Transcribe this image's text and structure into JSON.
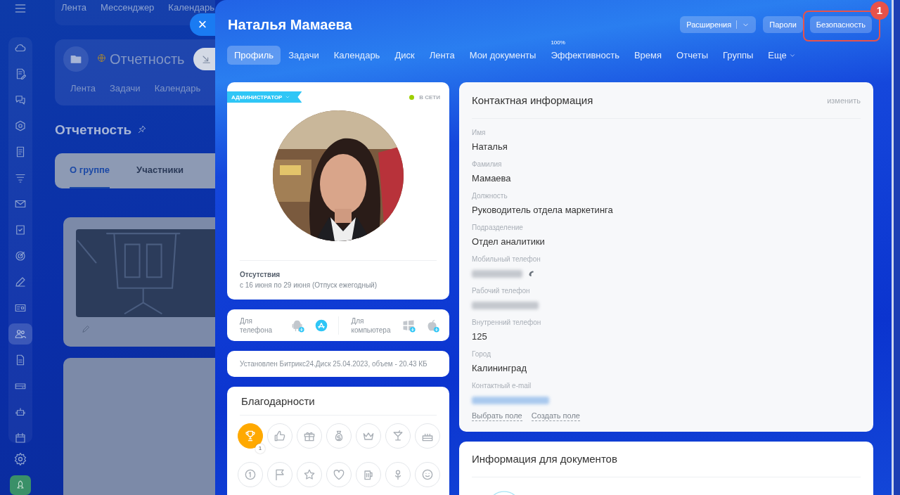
{
  "backdrop": {
    "nav": [
      "Лента",
      "Мессенджер",
      "Календарь"
    ],
    "sidebar": [
      {
        "selected": false
      },
      {
        "selected": false
      },
      {
        "selected": false
      },
      {
        "selected": false
      },
      {
        "selected": false
      },
      {
        "selected": false
      },
      {
        "selected": false
      },
      {
        "selected": false
      },
      {
        "selected": false
      },
      {
        "selected": false
      },
      {
        "selected": false
      },
      {
        "selected": true
      },
      {
        "selected": false
      },
      {
        "selected": false
      },
      {
        "selected": false
      },
      {
        "selected": false
      }
    ],
    "group": {
      "title": "Отчетность",
      "tabs": [
        "Лента",
        "Задачи",
        "Календарь"
      ]
    },
    "heading": "Отчетность",
    "sections": [
      {
        "label": "О группе",
        "selected": true
      },
      {
        "label": "Участники",
        "selected": false
      }
    ]
  },
  "close_button": "×",
  "slider": {
    "title": "Наталья Мамаева",
    "actions": [
      {
        "label": "Расширения",
        "kind": "split",
        "highlighted": false
      },
      {
        "label": "Пароли",
        "kind": "plain",
        "highlighted": false
      },
      {
        "label": "Безопасность",
        "kind": "plain",
        "highlighted": true
      }
    ],
    "callout": "1",
    "tabs": [
      {
        "label": "Профиль",
        "selected": true
      },
      {
        "label": "Задачи",
        "selected": false
      },
      {
        "label": "Календарь",
        "selected": false
      },
      {
        "label": "Диск",
        "selected": false
      },
      {
        "label": "Лента",
        "selected": false
      },
      {
        "label": "Мои документы",
        "selected": false
      },
      {
        "label": "Эффективность",
        "selected": false,
        "badge": "100%"
      },
      {
        "label": "Время",
        "selected": false
      },
      {
        "label": "Отчеты",
        "selected": false
      },
      {
        "label": "Группы",
        "selected": false
      },
      {
        "label": "Еще",
        "selected": false,
        "kind": "menu"
      }
    ]
  },
  "profile": {
    "role": "АДМИНИСТРАТОР",
    "status": {
      "label": "В СЕТИ",
      "online": true
    },
    "absence": {
      "title": "Отсутствия",
      "text": "с 16 июня по 29 июня (Отпуск ежегодный)"
    }
  },
  "apps": [
    {
      "label": "Для телефона",
      "kind": "phone"
    },
    {
      "label": "Для компьютера",
      "kind": "desktop"
    }
  ],
  "disk_note": "Установлен Битрикс24.Диск 25.04.2023, объем - 20.43 КБ",
  "awards": {
    "title": "Благодарности",
    "items": [
      {
        "active": true,
        "count": "1"
      },
      {
        "active": false
      },
      {
        "active": false
      },
      {
        "active": false
      },
      {
        "active": false
      },
      {
        "active": false
      },
      {
        "active": false
      },
      {
        "active": false
      },
      {
        "active": false
      },
      {
        "active": false
      },
      {
        "active": false
      },
      {
        "active": false
      },
      {
        "active": false
      },
      {
        "active": false
      }
    ]
  },
  "contact": {
    "title": "Контактная информация",
    "edit_link": "изменить",
    "fields": [
      {
        "label": "Имя",
        "kind": "text",
        "value": "Наталья"
      },
      {
        "label": "Фамилия",
        "kind": "text",
        "value": "Мамаева"
      },
      {
        "label": "Должность",
        "kind": "text",
        "value": "Руководитель отдела маркетинга"
      },
      {
        "label": "Подразделение",
        "kind": "text",
        "value": "Отдел аналитики"
      },
      {
        "label": "Мобильный телефон",
        "kind": "phone"
      },
      {
        "label": "Рабочий телефон",
        "kind": "hidden"
      },
      {
        "label": "Внутренний телефон",
        "kind": "text",
        "value": "125"
      },
      {
        "label": "Город",
        "kind": "text",
        "value": "Калининград"
      },
      {
        "label": "Контактный e-mail",
        "kind": "email"
      }
    ],
    "links": [
      "Выбрать поле",
      "Создать поле"
    ]
  },
  "documents": {
    "title": "Информация для документов"
  }
}
